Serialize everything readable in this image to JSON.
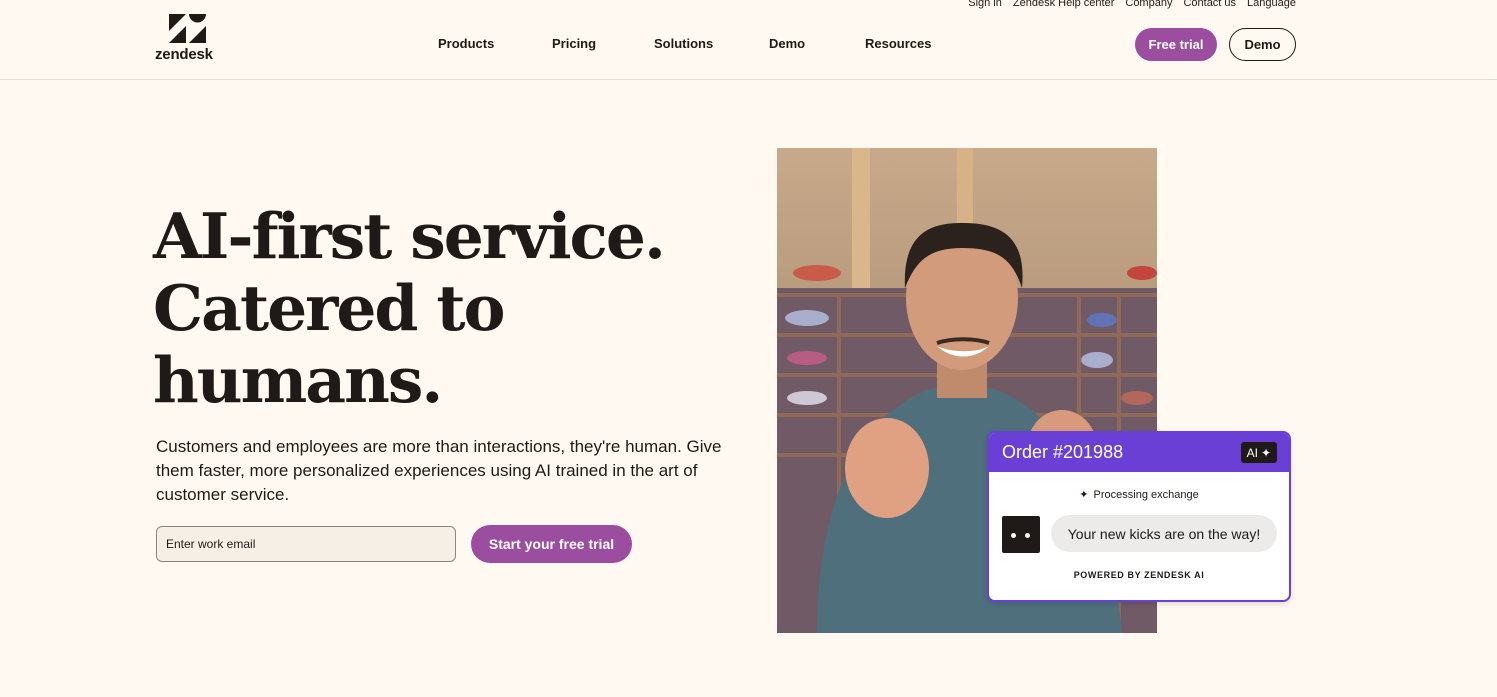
{
  "brand": {
    "name": "zendesk",
    "logo_icon": "zendesk-z-icon"
  },
  "utility_links": [
    "Sign in",
    "Zendesk Help center",
    "Company",
    "Contact us",
    "Language"
  ],
  "nav": {
    "items": [
      "Products",
      "Pricing",
      "Solutions",
      "Demo",
      "Resources"
    ]
  },
  "header_buttons": {
    "free_trial": "Free trial",
    "demo": "Demo"
  },
  "hero": {
    "headline": [
      "AI-first service.",
      "Catered to",
      "humans."
    ],
    "subcopy": "Customers and employees are more than interactions, they're human. Give them faster, more personalized experiences using AI trained in the art of customer service.",
    "email_placeholder": "Enter work email",
    "cta_label": "Start your free trial"
  },
  "chat_card": {
    "title": "Order #201988",
    "badge": "AI",
    "badge_icon": "sparkle-icon",
    "status": "Processing exchange",
    "status_icon": "sparkle-icon",
    "message": "Your new kicks are on the way!",
    "footer": "POWERED BY ZENDESK AI"
  },
  "colors": {
    "page_bg": "#fff9f1",
    "brand_purple": "#9b4d9f",
    "card_purple": "#6a3fd6",
    "ink": "#1f1a17"
  }
}
